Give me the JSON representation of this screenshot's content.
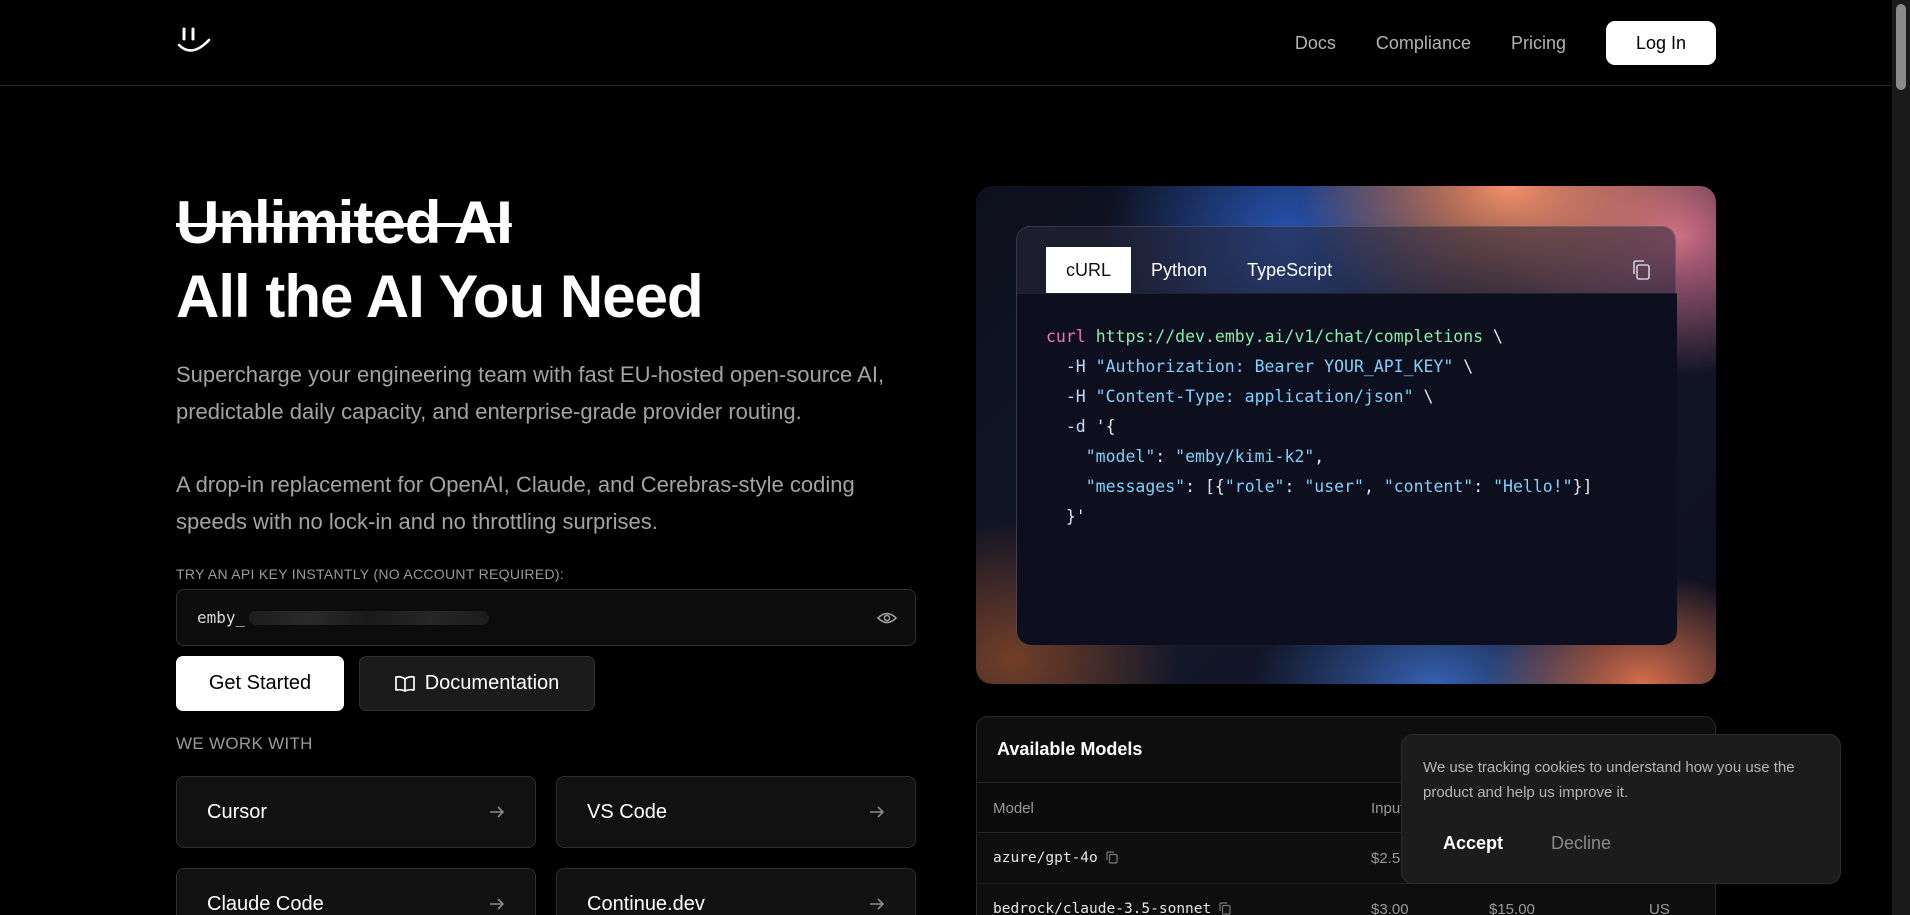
{
  "header": {
    "nav": [
      "Docs",
      "Compliance",
      "Pricing"
    ],
    "login_label": "Log In"
  },
  "hero": {
    "struck_title": "Unlimited AI",
    "title": "All the AI You Need",
    "subtitle": "Supercharge your engineering team with fast EU-hosted open-source AI, predictable daily capacity, and enterprise-grade provider routing.",
    "subtitle2": "A drop-in replacement for OpenAI, Claude, and Cerebras-style coding speeds with no lock-in and no throttling surprises."
  },
  "api_key": {
    "label": "TRY AN API KEY INSTANTLY (NO ACCOUNT REQUIRED):",
    "prefix": "emby_"
  },
  "buttons": {
    "get_started": "Get Started",
    "documentation": "Documentation"
  },
  "integrations": {
    "label": "WE WORK WITH",
    "items": [
      "Cursor",
      "VS Code",
      "Claude Code",
      "Continue.dev"
    ]
  },
  "code": {
    "tabs": [
      "cURL",
      "Python",
      "TypeScript"
    ],
    "active_tab": "cURL",
    "lines": {
      "l1_cmd": "curl",
      "l1_url": "https://dev.emby.ai/v1/chat/completions",
      "l1_tail": " \\",
      "l2_flag": "  -H ",
      "l2_str": "\"Authorization: Bearer YOUR_API_KEY\"",
      "l2_tail": " \\",
      "l3_flag": "  -H ",
      "l3_str": "\"Content-Type: application/json\"",
      "l3_tail": " \\",
      "l4_flag": "  -d ",
      "l4_tail": "'{",
      "l5_k": "\"model\"",
      "l5_v": "\"emby/kimi-k2\"",
      "l6_k": "\"messages\"",
      "l6_role_k": "\"role\"",
      "l6_role_v": "\"user\"",
      "l6_content_k": "\"content\"",
      "l6_content_v": "\"Hello!\"",
      "l7": "  }'"
    }
  },
  "models": {
    "title": "Available Models",
    "columns": [
      "Model",
      "Input"
    ],
    "rows": [
      {
        "name": "azure/gpt-4o",
        "input": "$2.5",
        "output": "",
        "region": ""
      },
      {
        "name": "bedrock/claude-3.5-sonnet",
        "input": "$3.00",
        "output": "$15.00",
        "region": "US"
      }
    ]
  },
  "cookie": {
    "text": "We use tracking cookies to understand how you use the product and help us improve it.",
    "accept": "Accept",
    "decline": "Decline"
  }
}
